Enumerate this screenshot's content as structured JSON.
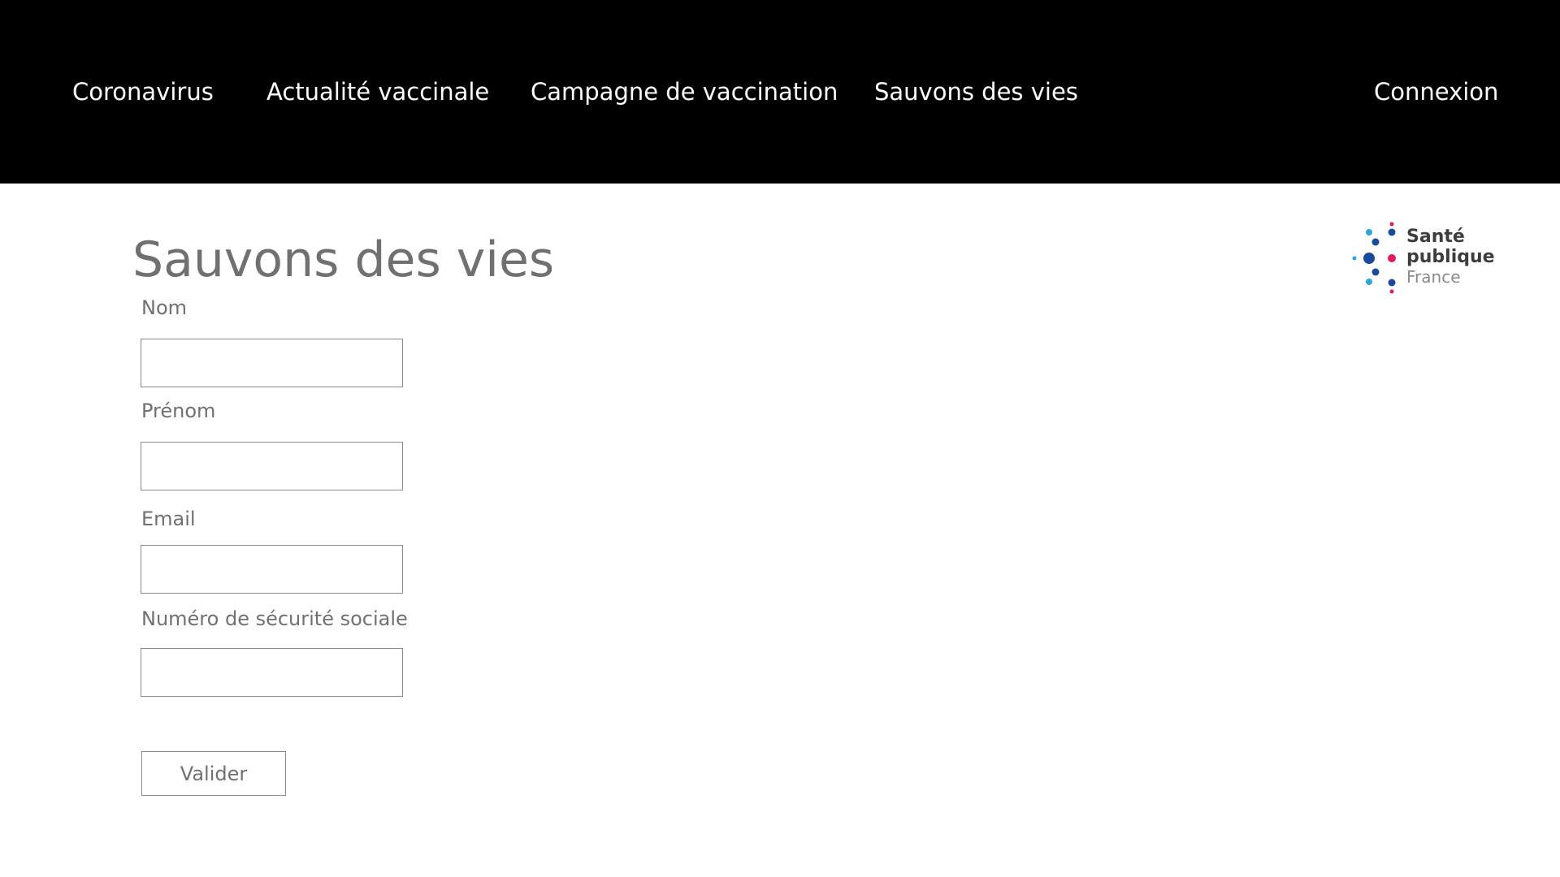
{
  "nav": {
    "items": [
      {
        "label": "Coronavirus"
      },
      {
        "label": "Actualité vaccinale"
      },
      {
        "label": "Campagne de vaccination"
      },
      {
        "label": "Sauvons des vies"
      }
    ],
    "login_label": "Connexion"
  },
  "page": {
    "title": "Sauvons des vies"
  },
  "form": {
    "fields": [
      {
        "label": "Nom",
        "value": ""
      },
      {
        "label": "Prénom",
        "value": ""
      },
      {
        "label": "Email",
        "value": ""
      },
      {
        "label": "Numéro de sécurité sociale",
        "value": ""
      }
    ],
    "submit_label": "Valider"
  },
  "logo": {
    "line1": "Santé",
    "line2": "publique",
    "line3": "France",
    "colors": {
      "blue_dark": "#1a4a9c",
      "blue_light": "#2aa7df",
      "pink": "#e5175f"
    }
  },
  "colors": {
    "header_bg": "#000000",
    "header_text": "#ffffff",
    "muted_text": "#707070"
  }
}
